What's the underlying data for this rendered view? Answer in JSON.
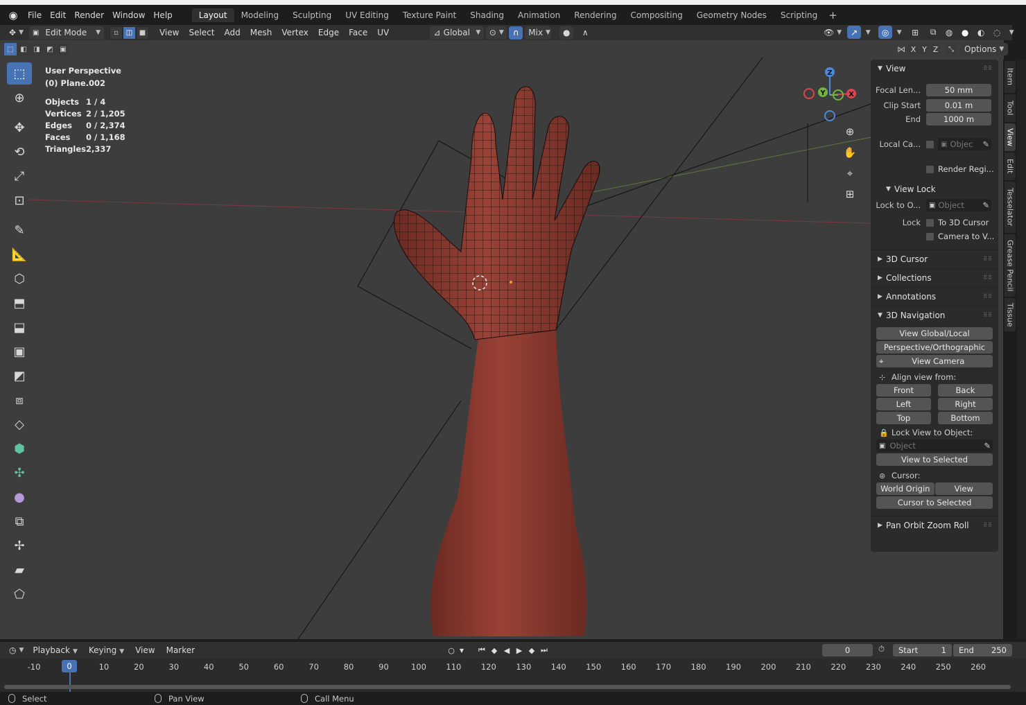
{
  "menubar": {
    "items": [
      "File",
      "Edit",
      "Render",
      "Window",
      "Help"
    ],
    "workspaces": [
      "Layout",
      "Modeling",
      "Sculpting",
      "UV Editing",
      "Texture Paint",
      "Shading",
      "Animation",
      "Rendering",
      "Compositing",
      "Geometry Nodes",
      "Scripting"
    ],
    "active_workspace": "Layout",
    "add_label": "+"
  },
  "header": {
    "mode": "Edit Mode",
    "menus": [
      "View",
      "Select",
      "Add",
      "Mesh",
      "Vertex",
      "Edge",
      "Face",
      "UV"
    ],
    "orientation": "Global",
    "snap_target": "Mix",
    "options_label": "Options",
    "axes": [
      "X",
      "Y",
      "Z"
    ]
  },
  "viewport": {
    "perspective": "User Perspective",
    "object": "(0) Plane.002",
    "stats": [
      {
        "k": "Objects",
        "v": "1 / 4"
      },
      {
        "k": "Vertices",
        "v": "2 / 1,205"
      },
      {
        "k": "Edges",
        "v": "0 / 2,374"
      },
      {
        "k": "Faces",
        "v": "0 / 1,168"
      },
      {
        "k": "Triangles",
        "v": "2,337"
      }
    ],
    "gizmo": {
      "z": "Z",
      "y": "Y",
      "x": "X"
    }
  },
  "npanel": {
    "view_section": "View",
    "focal_label": "Focal Len...",
    "focal_value": "50 mm",
    "clip_start_label": "Clip Start",
    "clip_start_value": "0.01 m",
    "end_label": "End",
    "end_value": "1000 m",
    "local_cam_label": "Local Ca...",
    "local_cam_placeholder": "Objec",
    "render_region_label": "Render Regi...",
    "view_lock_section": "View Lock",
    "lock_to_label": "Lock to O...",
    "lock_to_placeholder": "Object",
    "lock_label": "Lock",
    "to_3d_cursor": "To 3D Cursor",
    "camera_to_view": "Camera to V...",
    "sections": [
      "3D Cursor",
      "Collections",
      "Annotations"
    ],
    "nav_section": "3D Navigation",
    "view_global_local": "View Global/Local",
    "persp_ortho": "Perspective/Orthographic",
    "view_camera": "View Camera",
    "align_label": "Align view from:",
    "align_buttons": [
      "Front",
      "Back",
      "Left",
      "Right",
      "Top",
      "Bottom"
    ],
    "lock_view_label": "Lock View to Object:",
    "lock_view_placeholder": "Object",
    "view_to_selected": "View to Selected",
    "cursor_label": "Cursor:",
    "world_origin": "World Origin",
    "cursor_view": "View",
    "cursor_to_selected": "Cursor to Selected",
    "pan_section": "Pan Orbit Zoom Roll"
  },
  "sidetabs": [
    "Item",
    "Tool",
    "View",
    "Edit",
    "Tesselator",
    "Grease Pencil",
    "Tissue"
  ],
  "active_sidetab": "View",
  "timeline": {
    "menus": [
      "Playback",
      "Keying",
      "View",
      "Marker"
    ],
    "current_frame": "0",
    "start_label": "Start",
    "start_value": "1",
    "end_label": "End",
    "end_value": "250",
    "ticks": [
      "-10",
      "0",
      "10",
      "20",
      "30",
      "40",
      "50",
      "60",
      "70",
      "80",
      "90",
      "100",
      "110",
      "120",
      "130",
      "140",
      "150",
      "160",
      "170",
      "180",
      "190",
      "200",
      "210",
      "220",
      "230",
      "240",
      "250",
      "260"
    ],
    "playhead": "0"
  },
  "statusbar": {
    "select": "Select",
    "pan": "Pan View",
    "call_menu": "Call Menu"
  },
  "colors": {
    "accent": "#4772b3",
    "skin": "#8a3a30",
    "axis_x": "#e0424f",
    "axis_y": "#75b340",
    "axis_z": "#4a8ad8"
  }
}
